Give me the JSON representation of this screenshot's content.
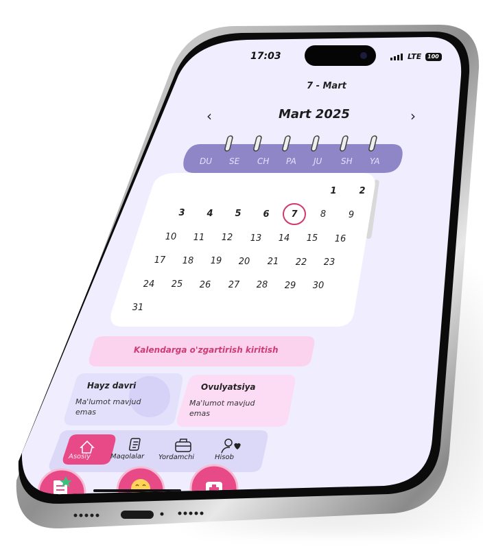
{
  "status_bar": {
    "time": "17:03",
    "network": "LTE",
    "battery": "100"
  },
  "header": {
    "date_title": "7 - Mart",
    "month_title": "Mart 2025",
    "prev_icon": "chevron-left-icon",
    "next_icon": "chevron-right-icon"
  },
  "calendar": {
    "weekdays": [
      "DU",
      "SE",
      "CH",
      "PA",
      "JU",
      "SH",
      "YA"
    ],
    "days": [
      "1",
      "2",
      "3",
      "4",
      "5",
      "6",
      "7",
      "8",
      "9",
      "10",
      "11",
      "12",
      "13",
      "14",
      "15",
      "16",
      "17",
      "18",
      "19",
      "20",
      "21",
      "22",
      "23",
      "24",
      "25",
      "26",
      "27",
      "28",
      "29",
      "30",
      "31"
    ],
    "selected_day": "7"
  },
  "edit_button": {
    "label": "Kalendarga o'zgartirish kiritish"
  },
  "cards": {
    "period": {
      "title": "Hayz davri",
      "text": "Ma'lumot mavjud emas"
    },
    "ovulation": {
      "title": "Ovulyatsiya",
      "text": "Ma'lumot mavjud emas"
    }
  },
  "nav": {
    "items": [
      {
        "label": "Asosiy",
        "icon": "home-icon"
      },
      {
        "label": "Maqolalar",
        "icon": "article-icon"
      },
      {
        "label": "Yordamchi",
        "icon": "briefcase-icon"
      },
      {
        "label": "Hisob",
        "icon": "user-heart-icon"
      }
    ],
    "active": "Asosiy"
  },
  "colors": {
    "screen_bg": "#f0eefe",
    "week_bar": "#8f86c8",
    "accent_pink": "#e74a87",
    "today_ring": "#d2366b",
    "edit_button_bg": "#fbd3ee"
  }
}
